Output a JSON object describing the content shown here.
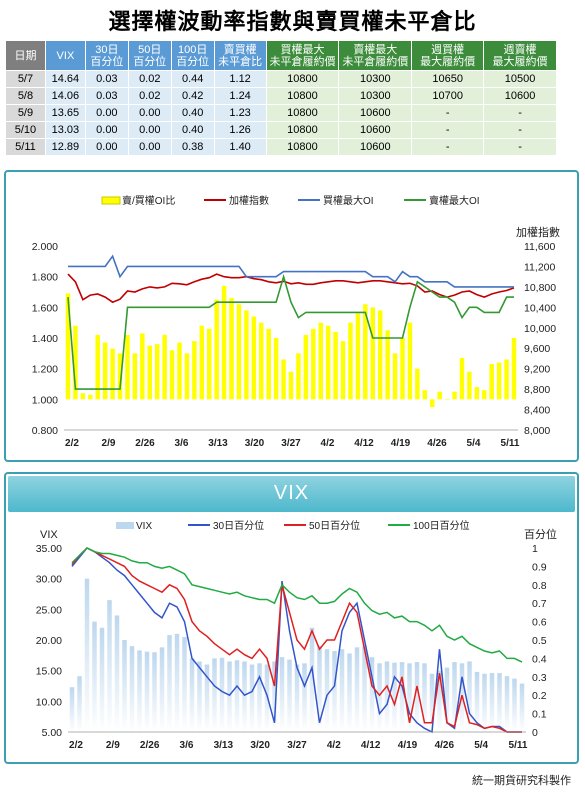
{
  "title": "選擇權波動率指數與賣買權未平倉比",
  "table": {
    "headers": [
      "日期",
      "VIX",
      "30日\n百分位",
      "50日\n百分位",
      "100日\n百分位",
      "賣買權\n未平倉比",
      "買權最大\n未平倉履約價",
      "賣權最大\n未平倉履約價",
      "週買權\n最大履約價",
      "週賣權\n最大履約價"
    ],
    "rows": [
      [
        "5/7",
        "14.64",
        "0.03",
        "0.02",
        "0.44",
        "1.12",
        "10800",
        "10300",
        "10650",
        "10500"
      ],
      [
        "5/8",
        "14.06",
        "0.03",
        "0.02",
        "0.42",
        "1.24",
        "10800",
        "10300",
        "10700",
        "10600"
      ],
      [
        "5/9",
        "13.65",
        "0.00",
        "0.00",
        "0.40",
        "1.23",
        "10800",
        "10600",
        "-",
        "-"
      ],
      [
        "5/10",
        "13.03",
        "0.00",
        "0.00",
        "0.40",
        "1.26",
        "10800",
        "10600",
        "-",
        "-"
      ],
      [
        "5/11",
        "12.89",
        "0.00",
        "0.00",
        "0.38",
        "1.40",
        "10800",
        "10600",
        "-",
        "-"
      ]
    ]
  },
  "vix_banner": "VIX",
  "footer": "統一期貨研究科製作",
  "chart_data": [
    {
      "type": "bar",
      "legend": [
        "賣/買權OI比",
        "加權指數",
        "買權最大OI",
        "賣權最大OI"
      ],
      "x_ticks": [
        "2/2",
        "2/9",
        "2/26",
        "3/6",
        "3/13",
        "3/20",
        "3/27",
        "4/2",
        "4/12",
        "4/19",
        "4/26",
        "5/4",
        "5/11"
      ],
      "left_axis": {
        "ticks": [
          "2.000",
          "1.800",
          "1.600",
          "1.400",
          "1.200",
          "1.000",
          "0.800"
        ],
        "ylim": [
          0.8,
          2.0
        ]
      },
      "right_axis": {
        "label": "加權指數",
        "ticks": [
          "11,600",
          "11,200",
          "10,800",
          "10,400",
          "10,000",
          "9,600",
          "9,200",
          "8,800",
          "8,400",
          "8,000"
        ],
        "ylim": [
          8000,
          11600
        ]
      },
      "series": [
        {
          "name": "賣/買權OI比",
          "type": "bar",
          "axis": "left",
          "color": "#ffff00",
          "values": [
            1.69,
            1.48,
            1.04,
            1.03,
            1.42,
            1.37,
            1.33,
            1.3,
            1.42,
            1.3,
            1.43,
            1.35,
            1.36,
            1.42,
            1.32,
            1.37,
            1.3,
            1.38,
            1.48,
            1.46,
            1.65,
            1.74,
            1.66,
            1.62,
            1.58,
            1.54,
            1.5,
            1.46,
            1.4,
            1.26,
            1.18,
            1.3,
            1.42,
            1.46,
            1.5,
            1.48,
            1.44,
            1.38,
            1.5,
            1.56,
            1.62,
            1.6,
            1.58,
            1.45,
            1.3,
            1.4,
            1.5,
            1.2,
            1.06,
            0.95,
            1.05,
            1.0,
            1.05,
            1.27,
            1.18,
            1.08,
            1.06,
            1.23,
            1.24,
            1.26,
            1.4
          ]
        },
        {
          "name": "加權指數",
          "type": "line",
          "axis": "right",
          "color": "#c00000",
          "values": [
            11050,
            10900,
            10550,
            10640,
            10660,
            10600,
            10500,
            10560,
            10720,
            10700,
            10760,
            10800,
            10780,
            10800,
            10870,
            10860,
            10840,
            10900,
            10950,
            10980,
            11050,
            11000,
            10980,
            10980,
            11000,
            10960,
            10940,
            10900,
            10880,
            10910,
            10860,
            10880,
            10850,
            10850,
            10880,
            10900,
            10920,
            10920,
            10900,
            10880,
            10900,
            10920,
            10920,
            10900,
            10880,
            10860,
            10870,
            10820,
            10700,
            10720,
            10650,
            10600,
            10640,
            10700,
            10720,
            10650,
            10600,
            10660,
            10700,
            10730,
            10780
          ]
        },
        {
          "name": "買權最大OI",
          "type": "line",
          "axis": "right",
          "color": "#4472c4",
          "values": [
            11200,
            11200,
            11200,
            11200,
            11200,
            11200,
            11400,
            11000,
            11200,
            11200,
            11200,
            11200,
            11200,
            11200,
            11200,
            11200,
            11200,
            11200,
            11200,
            11200,
            11200,
            11200,
            11200,
            11200,
            11000,
            11000,
            11000,
            11000,
            11000,
            11100,
            11100,
            11100,
            11100,
            11100,
            11100,
            11100,
            11100,
            11100,
            11100,
            11100,
            11100,
            11000,
            11000,
            11000,
            10900,
            11100,
            11000,
            11000,
            10900,
            10900,
            10900,
            10900,
            10800,
            10800,
            10800,
            10800,
            10800,
            10800,
            10800,
            10800,
            10800
          ]
        },
        {
          "name": "賣權最大OI",
          "type": "line",
          "axis": "right",
          "color": "#339933",
          "values": [
            10600,
            8800,
            8800,
            8800,
            8800,
            8800,
            8800,
            8800,
            10400,
            10400,
            10400,
            10400,
            10400,
            10400,
            10400,
            10400,
            10400,
            10400,
            10400,
            10400,
            10500,
            10500,
            10500,
            10500,
            10500,
            10500,
            10500,
            10500,
            10500,
            11000,
            10500,
            10200,
            10300,
            10300,
            10300,
            10300,
            10300,
            10300,
            10300,
            10300,
            10300,
            9800,
            9800,
            9800,
            9800,
            9800,
            10400,
            10900,
            10800,
            10700,
            10600,
            10600,
            10500,
            10200,
            10400,
            10400,
            10300,
            10300,
            10300,
            10600,
            10600
          ]
        }
      ]
    },
    {
      "type": "line",
      "legend": [
        "VIX",
        "30日百分位",
        "50日百分位",
        "100日百分位"
      ],
      "x_ticks": [
        "2/2",
        "2/9",
        "2/26",
        "3/6",
        "3/13",
        "3/20",
        "3/27",
        "4/2",
        "4/12",
        "4/19",
        "4/26",
        "5/4",
        "5/11"
      ],
      "left_axis": {
        "label": "VIX",
        "ticks": [
          "35.00",
          "30.00",
          "25.00",
          "20.00",
          "15.00",
          "10.00",
          "5.00"
        ],
        "ylim": [
          5,
          35
        ]
      },
      "right_axis": {
        "label": "百分位",
        "ticks": [
          "1",
          "0.9",
          "0.8",
          "0.7",
          "0.6",
          "0.5",
          "0.4",
          "0.3",
          "0.2",
          "0.1",
          "0"
        ],
        "ylim": [
          0,
          1
        ]
      },
      "series": [
        {
          "name": "VIX",
          "type": "bar",
          "axis": "left",
          "color": "#bdd7ee",
          "values": [
            12.3,
            14.1,
            30.0,
            23.0,
            22.0,
            26.5,
            24.0,
            20.0,
            19.0,
            18.3,
            18.1,
            18.0,
            18.8,
            20.8,
            21.0,
            20.5,
            17.0,
            16.5,
            16.0,
            17.0,
            17.1,
            16.5,
            16.7,
            16.5,
            16.0,
            16.2,
            16.0,
            16.5,
            17.2,
            16.8,
            16.0,
            16.2,
            22.0,
            19.0,
            18.5,
            18.2,
            18.5,
            17.8,
            18.8,
            19.0,
            17.2,
            16.2,
            16.5,
            16.3,
            16.4,
            16.2,
            16.4,
            16.2,
            14.5,
            15.0,
            15.5,
            16.4,
            16.2,
            16.5,
            14.8,
            14.5,
            14.6,
            14.6,
            14.1,
            13.7,
            12.9
          ]
        },
        {
          "name": "30日百分位",
          "type": "line",
          "axis": "right",
          "color": "#3355cc",
          "values": [
            0.9,
            0.95,
            1.0,
            0.98,
            0.95,
            0.92,
            0.88,
            0.85,
            0.8,
            0.75,
            0.7,
            0.65,
            0.62,
            0.7,
            0.68,
            0.6,
            0.4,
            0.35,
            0.3,
            0.25,
            0.22,
            0.2,
            0.25,
            0.2,
            0.22,
            0.3,
            0.2,
            0.05,
            0.82,
            0.55,
            0.35,
            0.25,
            0.35,
            0.05,
            0.2,
            0.25,
            0.55,
            0.65,
            0.7,
            0.5,
            0.3,
            0.1,
            0.15,
            0.3,
            0.25,
            0.1,
            0.05,
            0.02,
            0.0,
            0.45,
            0.05,
            0.02,
            0.3,
            0.1,
            0.05,
            0.02,
            0.03,
            0.03,
            0.0,
            0.0,
            0.0
          ]
        },
        {
          "name": "50日百分位",
          "type": "line",
          "axis": "right",
          "color": "#e02020",
          "values": [
            0.91,
            0.96,
            1.0,
            0.98,
            0.96,
            0.94,
            0.92,
            0.9,
            0.85,
            0.82,
            0.8,
            0.78,
            0.76,
            0.8,
            0.78,
            0.72,
            0.6,
            0.55,
            0.52,
            0.48,
            0.45,
            0.42,
            0.45,
            0.42,
            0.4,
            0.45,
            0.4,
            0.25,
            0.8,
            0.65,
            0.5,
            0.45,
            0.55,
            0.45,
            0.5,
            0.5,
            0.6,
            0.7,
            0.65,
            0.45,
            0.25,
            0.2,
            0.25,
            0.15,
            0.3,
            0.05,
            0.25,
            0.05,
            0.05,
            0.32,
            0.05,
            0.03,
            0.2,
            0.05,
            0.04,
            0.02,
            0.03,
            0.02,
            0.0,
            0.0,
            0.0
          ]
        },
        {
          "name": "100日百分位",
          "type": "line",
          "axis": "right",
          "color": "#22aa44",
          "values": [
            0.92,
            0.96,
            1.0,
            0.98,
            0.97,
            0.97,
            0.96,
            0.95,
            0.93,
            0.92,
            0.92,
            0.9,
            0.89,
            0.9,
            0.88,
            0.86,
            0.8,
            0.79,
            0.78,
            0.77,
            0.76,
            0.75,
            0.76,
            0.74,
            0.73,
            0.72,
            0.72,
            0.7,
            0.8,
            0.76,
            0.73,
            0.72,
            0.74,
            0.7,
            0.7,
            0.71,
            0.75,
            0.78,
            0.76,
            0.7,
            0.66,
            0.64,
            0.65,
            0.62,
            0.63,
            0.6,
            0.6,
            0.58,
            0.55,
            0.58,
            0.52,
            0.5,
            0.52,
            0.48,
            0.46,
            0.44,
            0.43,
            0.44,
            0.4,
            0.4,
            0.38
          ]
        }
      ]
    }
  ]
}
